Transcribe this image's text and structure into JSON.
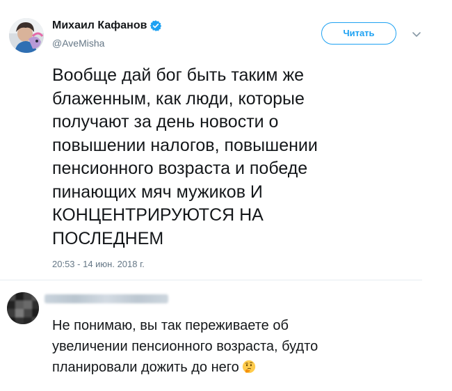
{
  "tweet": {
    "author_name": "Михаил Кафанов",
    "author_handle": "@AveMisha",
    "follow_label": "Читать",
    "text": "Вообще дай бог быть таким же\nблаженным, как люди, которые\nполучают за день новости о\nповышении налогов, повышении\nпенсионного возраста и победе\nпинающих мяч мужиков И\nКОНЦЕНТРИРУЮТСЯ НА\nПОСЛЕДНЕМ",
    "timestamp": "20:53 - 14 июн. 2018 г.",
    "verified_icon": "verified-badge",
    "caret_icon": "chevron-down"
  },
  "reply": {
    "text": "Не понимаю, вы так переживаете об\nувеличении пенсионного возраста, будто\nпланировали дожить до него",
    "emoji": "thinking-face"
  },
  "colors": {
    "accent": "#1da1f2",
    "text": "#14171a",
    "secondary": "#657786",
    "divider": "#e6ecf0"
  }
}
